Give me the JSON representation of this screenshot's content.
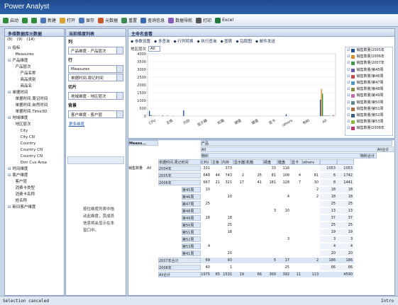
{
  "app": {
    "title": "Power Analyst"
  },
  "toolbar": [
    {
      "label": "启动",
      "icon": "start-icon",
      "color": "#2f8a3a"
    },
    {
      "label": "",
      "icon": "back-icon",
      "color": "#2f8a3a"
    },
    {
      "label": "",
      "icon": "forward-icon",
      "color": "#2f8a3a"
    },
    {
      "label": "新建",
      "icon": "new-icon",
      "color": "#4a78b8"
    },
    {
      "label": "打开",
      "icon": "open-icon",
      "color": "#d8a22c"
    },
    {
      "label": "保存",
      "icon": "save-icon",
      "color": "#4a78b8"
    },
    {
      "label": "元数据",
      "icon": "metadata-icon",
      "color": "#c85a2a"
    },
    {
      "label": "重置",
      "icon": "reset-icon",
      "color": "#3c8a50"
    },
    {
      "label": "查询信息",
      "icon": "info-icon",
      "color": "#3b6ab0"
    },
    {
      "label": "数据导航",
      "icon": "navigation-icon",
      "color": "#8a5ab8"
    },
    {
      "label": "打印",
      "icon": "print-icon",
      "color": "#555555"
    },
    {
      "label": "Excel",
      "icon": "excel-icon",
      "color": "#1f7a3a"
    }
  ],
  "left": {
    "title": "多维数据库元数据",
    "tabs": [
      "(8)",
      "(9)",
      "(14)"
    ],
    "items": [
      {
        "t": "指标",
        "d": 0,
        "k": "fold"
      },
      {
        "t": "Measures",
        "d": 1
      },
      {
        "t": "产品维度",
        "d": 0,
        "k": "fold"
      },
      {
        "t": "产品层次",
        "d": 1
      },
      {
        "t": "产品名称",
        "d": 2
      },
      {
        "t": "商品类别",
        "d": 2
      },
      {
        "t": "商品名",
        "d": 2
      },
      {
        "t": "单据时间",
        "d": 0,
        "k": "fold"
      },
      {
        "t": "单据时间.周记时间",
        "d": 1
      },
      {
        "t": "单据时间.自然时间",
        "d": 1
      },
      {
        "t": "单据时间.Time3D",
        "d": 1
      },
      {
        "t": "地域维度",
        "d": 0,
        "k": "fold"
      },
      {
        "t": "地区层次",
        "d": 1
      },
      {
        "t": "City",
        "d": 2
      },
      {
        "t": "City CN",
        "d": 2
      },
      {
        "t": "Country",
        "d": 2
      },
      {
        "t": "Country CN",
        "d": 2
      },
      {
        "t": "Country CN",
        "d": 2
      },
      {
        "t": "Dim Cus Area",
        "d": 2
      },
      {
        "t": "时间维度",
        "d": 0,
        "k": "fold"
      },
      {
        "t": "客户维度",
        "d": 0,
        "k": "fold"
      },
      {
        "t": "客户层",
        "d": 1
      },
      {
        "t": "消费卡类型",
        "d": 1
      },
      {
        "t": "消费卡名称",
        "d": 1
      },
      {
        "t": "姓名称",
        "d": 1
      },
      {
        "t": "新旧客户维度",
        "d": 0,
        "k": "fold"
      }
    ]
  },
  "mid": {
    "title": "当前维度列表",
    "rows_label": "列",
    "rows_value": "产品维度 - 产品层次",
    "cols_label": "行",
    "cols_values": [
      "Measures",
      "单据时间.周记时间"
    ],
    "slice_label": "切片",
    "slice_value": "地域维度 - 地区层次",
    "bg_label": "背景",
    "bg_value": "客户维度 - 客户层",
    "other_link": "更多维度",
    "help": "按住维度列表中拖动此维度，其成员信息将会显示在本窗口中。"
  },
  "main": {
    "title": "主命名查看",
    "tools": [
      "参数设置",
      "多查询",
      "行列转换",
      "执行查询",
      "图表",
      "钻取图",
      "邮件发送"
    ],
    "filter_label": "地区层次",
    "filter_value": "All"
  },
  "chart_data": {
    "type": "bar",
    "categories": [
      "CPU",
      "主板",
      "内存",
      "显示器",
      "机箱",
      "硬盘",
      "键盘",
      "显卡",
      "others",
      "物料",
      "All"
    ],
    "series": [
      {
        "name": "销售数量/2005年",
        "color": "#1f4e9a",
        "values": [
          331,
          0,
          373,
          0,
          0,
          0,
          0,
          0,
          116,
          0,
          1053
        ]
      },
      {
        "name": "销售数量/2006年",
        "color": "#d68a2a",
        "values": [
          48,
          44,
          0,
          2,
          0,
          0,
          0,
          6,
          0,
          0,
          1742
        ]
      },
      {
        "name": "销售数量/2007年",
        "color": "#3a9a4a",
        "values": [
          66,
          0,
          0,
          0,
          0,
          0,
          0,
          0,
          7,
          0,
          1441
        ]
      },
      {
        "name": "销售数量/第45周",
        "color": "#6a5ab8",
        "values": [
          0,
          0,
          0,
          0,
          0,
          0,
          0,
          0,
          0,
          0,
          18
        ]
      },
      {
        "name": "销售数量/第46周",
        "color": "#c84a4a",
        "values": [
          25,
          0,
          0,
          0,
          0,
          0,
          0,
          0,
          0,
          0,
          25
        ]
      },
      {
        "name": "销售数量/第47周",
        "color": "#4a9ac8",
        "values": [
          0,
          0,
          0,
          0,
          0,
          0,
          3,
          0,
          0,
          0,
          25
        ]
      },
      {
        "name": "销售数量/第48周",
        "color": "#8a8a3a",
        "values": [
          15,
          18,
          0,
          0,
          0,
          0,
          0,
          0,
          0,
          0,
          37
        ]
      },
      {
        "name": "销售数量/第49周",
        "color": "#c86aa8",
        "values": [
          0,
          0,
          0,
          0,
          0,
          0,
          0,
          0,
          0,
          0,
          25
        ]
      },
      {
        "name": "销售数量/第50周",
        "color": "#5a8a8a",
        "values": [
          0,
          0,
          0,
          0,
          0,
          0,
          0,
          0,
          0,
          0,
          19
        ]
      },
      {
        "name": "销售数量/第51周",
        "color": "#a86a3a",
        "values": [
          0,
          0,
          0,
          0,
          0,
          0,
          0,
          0,
          0,
          0,
          3
        ]
      },
      {
        "name": "销售数量/第52周",
        "color": "#3a5a8a",
        "values": [
          0,
          0,
          0,
          0,
          0,
          0,
          0,
          0,
          0,
          0,
          4
        ]
      },
      {
        "name": "销售数量/第53周",
        "color": "#8ab83a",
        "values": [
          0,
          0,
          0,
          0,
          0,
          0,
          0,
          0,
          0,
          0,
          20
        ]
      },
      {
        "name": "销售数量/2008年",
        "color": "#b83a6a",
        "values": [
          40,
          1,
          0,
          0,
          0,
          0,
          0,
          0,
          0,
          0,
          66
        ]
      }
    ],
    "ylim": [
      0,
      4000
    ],
    "yticks": [
      0,
      500,
      1000,
      1500,
      2000,
      2500,
      3000,
      3500,
      4000
    ]
  },
  "grid": {
    "corner": "Measu...",
    "row_dim": "单据时间.周记时间",
    "col_dim": "产品",
    "all": "All",
    "material": "物料",
    "material_all": "物料合计",
    "all_total": "All合计",
    "measure": "销售数量",
    "cols": [
      "CPU",
      "主板",
      "内存",
      "显示器",
      "机箱",
      "硬盘",
      "键盘",
      "显卡",
      "others"
    ],
    "rows": [
      {
        "l": "2004年",
        "v": [
          "331",
          "",
          "373",
          "",
          "",
          "33",
          "116",
          "",
          "",
          "1053",
          "1053"
        ]
      },
      {
        "l": "2005年",
        "v": [
          "648",
          "44",
          "743",
          "2",
          "25",
          "81",
          "108",
          "4",
          "81",
          "6",
          "1742"
        ]
      },
      {
        "l": "2006年",
        "v": [
          "667",
          "21",
          "321",
          "17",
          "41",
          "181",
          "128",
          "7",
          "30",
          "8",
          "1441"
        ]
      },
      {
        "l": "第45周",
        "v": [
          "10",
          "",
          "",
          "",
          "",
          "",
          "",
          "",
          "2",
          "18",
          "18"
        ]
      },
      {
        "l": "第46周",
        "v": [
          "",
          "",
          "10",
          "",
          "",
          "",
          "4",
          "",
          "2",
          "18",
          "18"
        ]
      },
      {
        "l": "第47周",
        "v": [
          "25",
          "",
          "",
          "",
          "",
          "",
          "",
          "",
          "",
          "25",
          "25"
        ]
      },
      {
        "l": "第48周",
        "v": [
          "",
          "",
          "",
          "",
          "",
          "3",
          "10",
          "",
          "",
          "13",
          "13"
        ]
      },
      {
        "l": "第49周",
        "v": [
          "18",
          "",
          "18",
          "",
          "",
          "",
          "",
          "",
          "",
          "37",
          "37"
        ]
      },
      {
        "l": "第50周",
        "v": [
          "",
          "",
          "25",
          "",
          "",
          "",
          "",
          "",
          "",
          "25",
          "25"
        ]
      },
      {
        "l": "第51周",
        "v": [
          "",
          "",
          "18",
          "",
          "",
          "",
          "",
          "",
          "",
          "19",
          "19"
        ]
      },
      {
        "l": "第52周",
        "v": [
          "",
          "",
          "",
          "",
          "",
          "",
          "3",
          "",
          "",
          "3",
          "3"
        ]
      },
      {
        "l": "第53周",
        "v": [
          "4",
          "",
          "",
          "",
          "",
          "",
          "",
          "",
          "",
          "4",
          "4"
        ]
      },
      {
        "l": "第41周",
        "v": [
          "",
          "",
          "20",
          "",
          "",
          "",
          "",
          "",
          "",
          "20",
          "20"
        ]
      },
      {
        "l": "2007年合计",
        "v": [
          "69",
          "",
          "93",
          "",
          "",
          "5",
          "17",
          "",
          "2",
          "186",
          "186"
        ]
      },
      {
        "l": "2008年",
        "v": [
          "40",
          "",
          "1",
          "",
          "",
          "",
          "25",
          "",
          "",
          "66",
          "66"
        ]
      },
      {
        "l": "All合计",
        "v": [
          "1975",
          "65",
          "1531",
          "19",
          "66",
          "300",
          "392",
          "11",
          "113",
          "",
          "4590"
        ]
      }
    ]
  },
  "status": {
    "text": "Selection canceled",
    "user": "Intro"
  }
}
